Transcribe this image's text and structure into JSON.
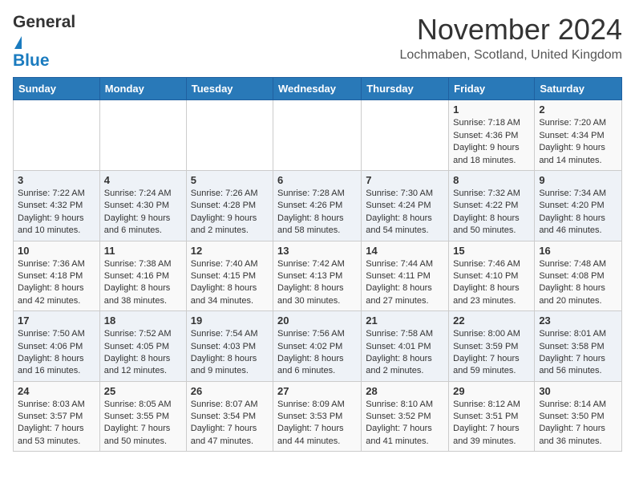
{
  "logo": {
    "line1": "General",
    "line2": "Blue"
  },
  "header": {
    "month": "November 2024",
    "location": "Lochmaben, Scotland, United Kingdom"
  },
  "weekdays": [
    "Sunday",
    "Monday",
    "Tuesday",
    "Wednesday",
    "Thursday",
    "Friday",
    "Saturday"
  ],
  "weeks": [
    [
      {
        "day": "",
        "info": ""
      },
      {
        "day": "",
        "info": ""
      },
      {
        "day": "",
        "info": ""
      },
      {
        "day": "",
        "info": ""
      },
      {
        "day": "",
        "info": ""
      },
      {
        "day": "1",
        "info": "Sunrise: 7:18 AM\nSunset: 4:36 PM\nDaylight: 9 hours\nand 18 minutes."
      },
      {
        "day": "2",
        "info": "Sunrise: 7:20 AM\nSunset: 4:34 PM\nDaylight: 9 hours\nand 14 minutes."
      }
    ],
    [
      {
        "day": "3",
        "info": "Sunrise: 7:22 AM\nSunset: 4:32 PM\nDaylight: 9 hours\nand 10 minutes."
      },
      {
        "day": "4",
        "info": "Sunrise: 7:24 AM\nSunset: 4:30 PM\nDaylight: 9 hours\nand 6 minutes."
      },
      {
        "day": "5",
        "info": "Sunrise: 7:26 AM\nSunset: 4:28 PM\nDaylight: 9 hours\nand 2 minutes."
      },
      {
        "day": "6",
        "info": "Sunrise: 7:28 AM\nSunset: 4:26 PM\nDaylight: 8 hours\nand 58 minutes."
      },
      {
        "day": "7",
        "info": "Sunrise: 7:30 AM\nSunset: 4:24 PM\nDaylight: 8 hours\nand 54 minutes."
      },
      {
        "day": "8",
        "info": "Sunrise: 7:32 AM\nSunset: 4:22 PM\nDaylight: 8 hours\nand 50 minutes."
      },
      {
        "day": "9",
        "info": "Sunrise: 7:34 AM\nSunset: 4:20 PM\nDaylight: 8 hours\nand 46 minutes."
      }
    ],
    [
      {
        "day": "10",
        "info": "Sunrise: 7:36 AM\nSunset: 4:18 PM\nDaylight: 8 hours\nand 42 minutes."
      },
      {
        "day": "11",
        "info": "Sunrise: 7:38 AM\nSunset: 4:16 PM\nDaylight: 8 hours\nand 38 minutes."
      },
      {
        "day": "12",
        "info": "Sunrise: 7:40 AM\nSunset: 4:15 PM\nDaylight: 8 hours\nand 34 minutes."
      },
      {
        "day": "13",
        "info": "Sunrise: 7:42 AM\nSunset: 4:13 PM\nDaylight: 8 hours\nand 30 minutes."
      },
      {
        "day": "14",
        "info": "Sunrise: 7:44 AM\nSunset: 4:11 PM\nDaylight: 8 hours\nand 27 minutes."
      },
      {
        "day": "15",
        "info": "Sunrise: 7:46 AM\nSunset: 4:10 PM\nDaylight: 8 hours\nand 23 minutes."
      },
      {
        "day": "16",
        "info": "Sunrise: 7:48 AM\nSunset: 4:08 PM\nDaylight: 8 hours\nand 20 minutes."
      }
    ],
    [
      {
        "day": "17",
        "info": "Sunrise: 7:50 AM\nSunset: 4:06 PM\nDaylight: 8 hours\nand 16 minutes."
      },
      {
        "day": "18",
        "info": "Sunrise: 7:52 AM\nSunset: 4:05 PM\nDaylight: 8 hours\nand 12 minutes."
      },
      {
        "day": "19",
        "info": "Sunrise: 7:54 AM\nSunset: 4:03 PM\nDaylight: 8 hours\nand 9 minutes."
      },
      {
        "day": "20",
        "info": "Sunrise: 7:56 AM\nSunset: 4:02 PM\nDaylight: 8 hours\nand 6 minutes."
      },
      {
        "day": "21",
        "info": "Sunrise: 7:58 AM\nSunset: 4:01 PM\nDaylight: 8 hours\nand 2 minutes."
      },
      {
        "day": "22",
        "info": "Sunrise: 8:00 AM\nSunset: 3:59 PM\nDaylight: 7 hours\nand 59 minutes."
      },
      {
        "day": "23",
        "info": "Sunrise: 8:01 AM\nSunset: 3:58 PM\nDaylight: 7 hours\nand 56 minutes."
      }
    ],
    [
      {
        "day": "24",
        "info": "Sunrise: 8:03 AM\nSunset: 3:57 PM\nDaylight: 7 hours\nand 53 minutes."
      },
      {
        "day": "25",
        "info": "Sunrise: 8:05 AM\nSunset: 3:55 PM\nDaylight: 7 hours\nand 50 minutes."
      },
      {
        "day": "26",
        "info": "Sunrise: 8:07 AM\nSunset: 3:54 PM\nDaylight: 7 hours\nand 47 minutes."
      },
      {
        "day": "27",
        "info": "Sunrise: 8:09 AM\nSunset: 3:53 PM\nDaylight: 7 hours\nand 44 minutes."
      },
      {
        "day": "28",
        "info": "Sunrise: 8:10 AM\nSunset: 3:52 PM\nDaylight: 7 hours\nand 41 minutes."
      },
      {
        "day": "29",
        "info": "Sunrise: 8:12 AM\nSunset: 3:51 PM\nDaylight: 7 hours\nand 39 minutes."
      },
      {
        "day": "30",
        "info": "Sunrise: 8:14 AM\nSunset: 3:50 PM\nDaylight: 7 hours\nand 36 minutes."
      }
    ]
  ]
}
